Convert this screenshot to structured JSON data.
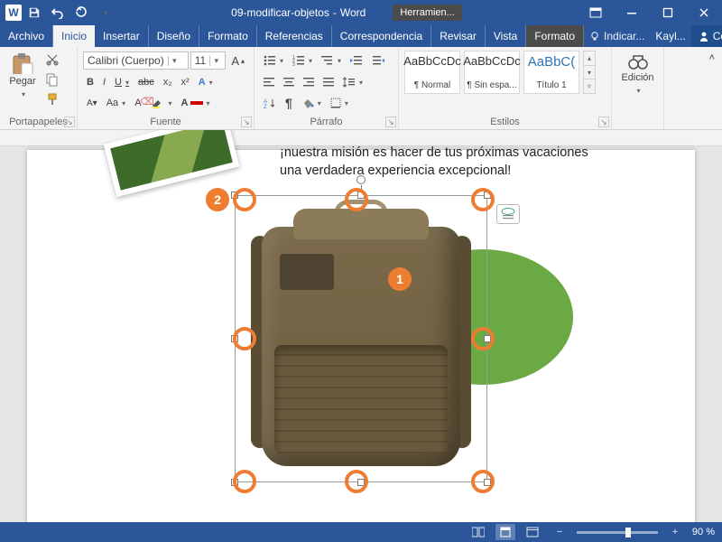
{
  "titlebar": {
    "doc_name": "09-modificar-objetos",
    "app_name": "Word",
    "context_tools": "Herramien..."
  },
  "tabs": {
    "file": "Archivo",
    "home": "Inicio",
    "insert": "Insertar",
    "design": "Diseño",
    "layout": "Formato",
    "references": "Referencias",
    "mailings": "Correspondencia",
    "review": "Revisar",
    "view": "Vista",
    "format_ctx": "Formato",
    "tell_me": "Indicar...",
    "user": "Kayl...",
    "share": "Compartir"
  },
  "ribbon": {
    "clipboard": {
      "label": "Portapapeles",
      "paste": "Pegar"
    },
    "font": {
      "label": "Fuente",
      "name": "Calibri (Cuerpo)",
      "size": "11",
      "bold": "B",
      "italic": "I",
      "underline": "U",
      "strike": "abc",
      "sub": "x₂",
      "sup": "x²"
    },
    "paragraph": {
      "label": "Párrafo"
    },
    "styles": {
      "label": "Estilos",
      "items": [
        {
          "preview": "AaBbCcDc",
          "name": "¶ Normal"
        },
        {
          "preview": "AaBbCcDc",
          "name": "¶ Sin espa..."
        },
        {
          "preview": "AaBbC(",
          "name": "Título 1"
        }
      ]
    },
    "editing": {
      "label": "Edición"
    }
  },
  "document": {
    "mission_line1": "¡nuestra misión es hacer de tus próximas vacaciones",
    "mission_line2": "una verdadera experiencia excepcional!",
    "callouts": {
      "one": "1",
      "two": "2"
    }
  },
  "statusbar": {
    "zoom": "90 %"
  }
}
